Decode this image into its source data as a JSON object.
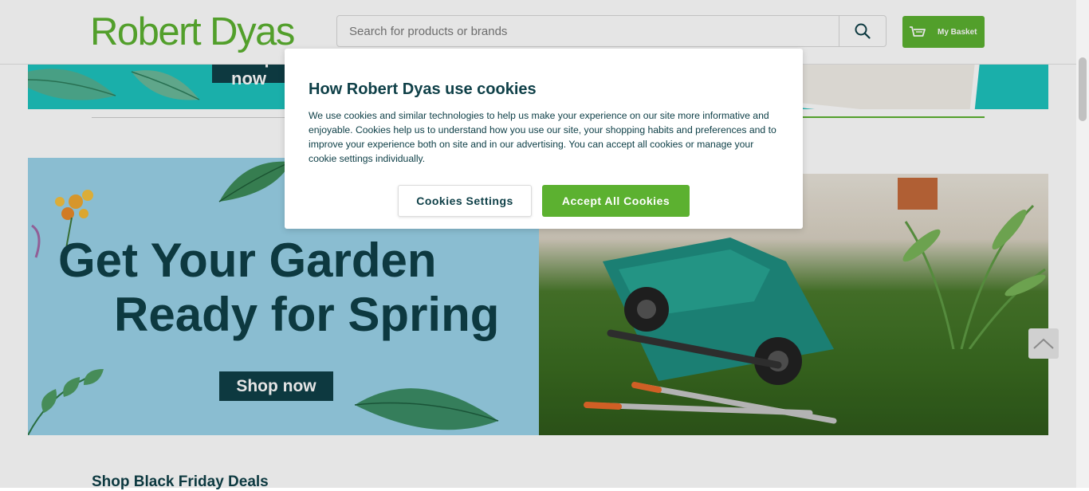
{
  "header": {
    "logo": "Robert Dyas",
    "search_placeholder": "Search for products or brands",
    "basket_label": "My Basket"
  },
  "promo_strip": {
    "button_label": "Shop now"
  },
  "banner": {
    "headline_line1": "Get Your Garden",
    "headline_line2": "Ready for Spring",
    "button_label": "Shop now"
  },
  "section": {
    "heading": "Shop Black Friday Deals"
  },
  "cookie_modal": {
    "title": "How Robert Dyas use cookies",
    "body": "We use cookies and similar technologies to help us make your experience on our site more informative and enjoyable. Cookies help us to understand how you use our site, your shopping habits and preferences and to improve your experience both on site and in our advertising. You can accept all cookies or manage your cookie settings individually.",
    "settings_label": "Cookies Settings",
    "accept_label": "Accept All Cookies"
  },
  "icons": {
    "search": "search-icon",
    "basket": "basket-icon",
    "scroll_top": "chevron-up-icon"
  },
  "colors": {
    "brand_green": "#5cb130",
    "dark_teal": "#0f4048",
    "promo_teal": "#1dc3be",
    "banner_blue": "#9ad3e9"
  }
}
